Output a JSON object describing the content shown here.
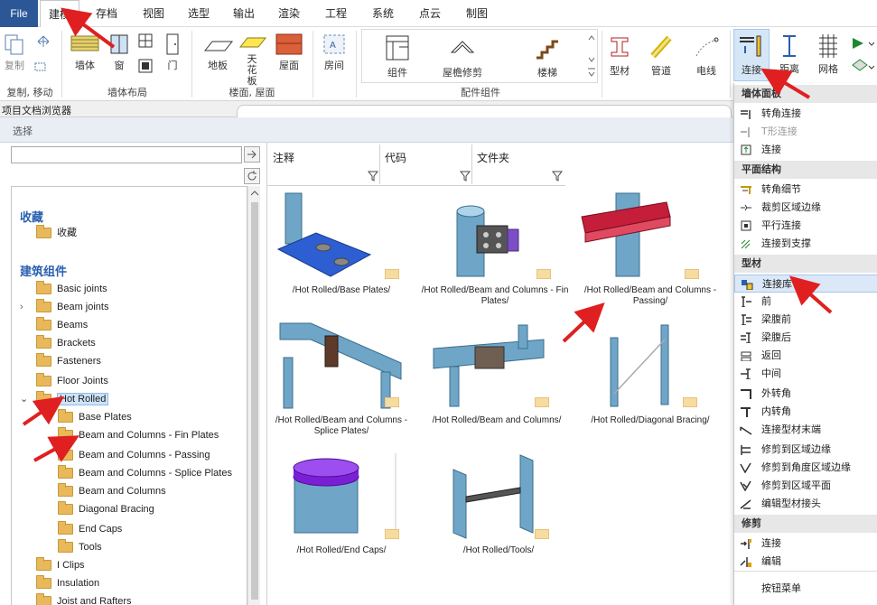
{
  "menubar": {
    "file": "File",
    "tabs": [
      "建模",
      "存档",
      "视图",
      "选型",
      "输出",
      "渲染",
      "工程",
      "系统",
      "点云",
      "制图"
    ]
  },
  "ribbon": {
    "copy_move_label": "复制, 移动",
    "copy_label": "复制",
    "wall_layout_label": "墙体布局",
    "wall_label": "墙体",
    "window_label": "窗",
    "door_label": "门",
    "floor_roof_label": "楼面, 屋面",
    "floor_label": "地板",
    "ceiling_label": "天花板",
    "roof_label": "屋面",
    "room_label": "房间",
    "component_label": "组件",
    "eave_trim_label": "屋檐修剪",
    "stair_label": "楼梯",
    "accessory_group_label": "配件组件",
    "profile_label": "型材",
    "pipe_label": "管道",
    "electric_label": "电线",
    "connect_label": "连接",
    "distance_label": "距离",
    "grid_label": "网格"
  },
  "window": {
    "subbar_title": "项目文档浏览器",
    "dialog_title": "选择"
  },
  "browser": {
    "search_value": "",
    "col_note": "注释",
    "col_code": "代码",
    "col_folder": "文件夹",
    "section_fav": "收藏",
    "fav_item": "收藏",
    "section_components": "建筑组件",
    "tree": [
      "Basic joints",
      "Beam joints",
      "Beams",
      "Brackets",
      "Fasteners",
      "Floor Joints",
      "Hot Rolled",
      "Base Plates",
      "Beam and Columns - Fin Plates",
      "Beam and Columns - Passing",
      "Beam and Columns - Splice Plates",
      "Beam and Columns",
      "Diagonal Bracing",
      "End Caps",
      "Tools",
      "I Clips",
      "Insulation",
      "Joist and Rafters"
    ]
  },
  "thumbs": [
    "/Hot Rolled/Base Plates/",
    "/Hot Rolled/Beam and Columns - Fin Plates/",
    "/Hot Rolled/Beam and Columns - Passing/",
    "/Hot Rolled/Beam and Columns - Splice Plates/",
    "/Hot Rolled/Beam and Columns/",
    "/Hot Rolled/Diagonal Bracing/",
    "/Hot Rolled/End Caps/",
    "/Hot Rolled/Tools/"
  ],
  "dropdown": {
    "h1": "墙体面板",
    "i1": "转角连接",
    "i2": "T形连接",
    "i3": "连接",
    "h2": "平面结构",
    "i4": "转角细节",
    "i5": "裁剪区域边缘",
    "i6": "平行连接",
    "i7": "连接到支撑",
    "h3": "型材",
    "i8": "连接库",
    "i9": "前",
    "i10": "梁腹前",
    "i11": "梁腹后",
    "i12": "返回",
    "i13": "中间",
    "i14": "外转角",
    "i15": "内转角",
    "i16": "连接型材末端",
    "i17": "修剪到区域边缘",
    "i18": "修剪到角度区域边缘",
    "i19": "修剪到区域平面",
    "i20": "编辑型材接头",
    "h4": "修剪",
    "i21": "连接",
    "i22": "编辑",
    "i23": "按钮菜单"
  },
  "colors": {
    "file_tab": "#2b5797",
    "accent": "#2a5fb0",
    "arrow": "#e02020",
    "steel": "#6fa6c8",
    "plate": "#2e5fd2",
    "beam_red": "#c41e3a",
    "cap_purple": "#7b1fd6"
  }
}
